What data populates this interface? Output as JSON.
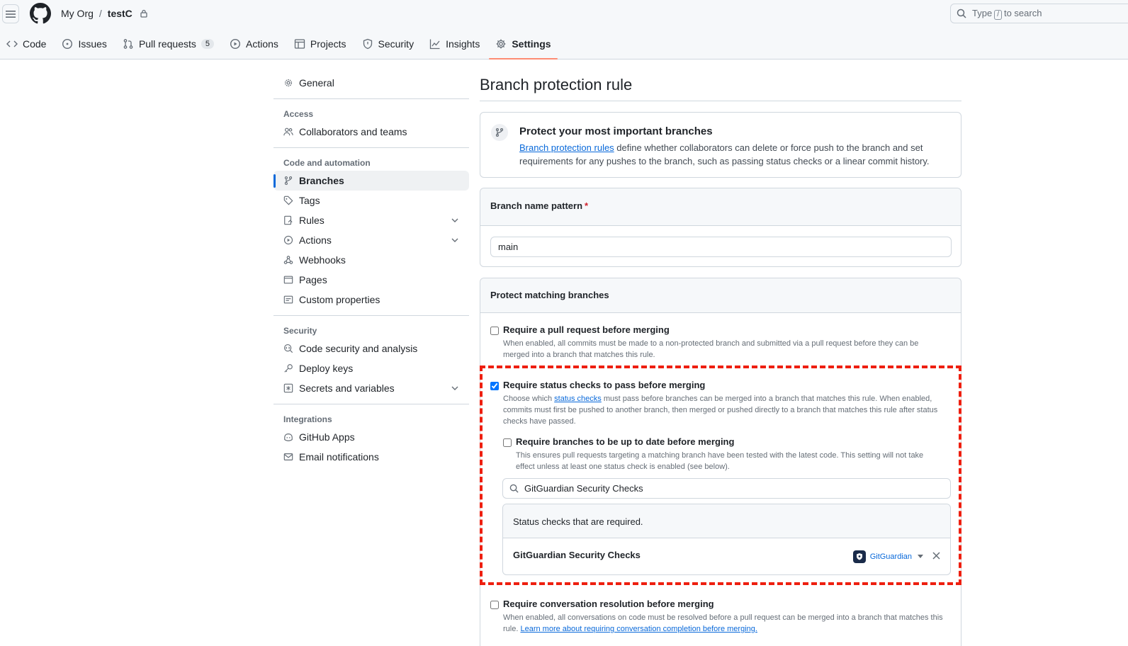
{
  "header": {
    "org": "My Org",
    "separator": "/",
    "repo": "testC",
    "search_pre": "Type",
    "search_key": "/",
    "search_post": "to search"
  },
  "tabs": [
    {
      "label": "Code",
      "icon": "code-icon"
    },
    {
      "label": "Issues",
      "icon": "issue-icon"
    },
    {
      "label": "Pull requests",
      "icon": "pull-request-icon",
      "count": "5"
    },
    {
      "label": "Actions",
      "icon": "play-icon"
    },
    {
      "label": "Projects",
      "icon": "table-icon"
    },
    {
      "label": "Security",
      "icon": "shield-icon"
    },
    {
      "label": "Insights",
      "icon": "graph-icon"
    },
    {
      "label": "Settings",
      "icon": "gear-icon",
      "active": true
    }
  ],
  "sidebar": {
    "general": "General",
    "access_heading": "Access",
    "collaborators": "Collaborators and teams",
    "code_heading": "Code and automation",
    "branches": "Branches",
    "tags": "Tags",
    "rules": "Rules",
    "actions": "Actions",
    "webhooks": "Webhooks",
    "pages": "Pages",
    "custom_properties": "Custom properties",
    "security_heading": "Security",
    "code_security": "Code security and analysis",
    "deploy_keys": "Deploy keys",
    "secrets": "Secrets and variables",
    "integrations_heading": "Integrations",
    "github_apps": "GitHub Apps",
    "email_notifications": "Email notifications"
  },
  "main": {
    "title": "Branch protection rule",
    "intro_title": "Protect your most important branches",
    "intro_link": "Branch protection rules",
    "intro_text": " define whether collaborators can delete or force push to the branch and set requirements for any pushes to the branch, such as passing status checks or a linear commit history.",
    "pattern_label": "Branch name pattern",
    "pattern_required": "*",
    "pattern_value": "main",
    "protect_heading": "Protect matching branches",
    "opt_pr_title": "Require a pull request before merging",
    "opt_pr_desc": "When enabled, all commits must be made to a non-protected branch and submitted via a pull request before they can be merged into a branch that matches this rule.",
    "opt_status_title": "Require status checks to pass before merging",
    "opt_status_desc_pre": "Choose which ",
    "opt_status_desc_link": "status checks",
    "opt_status_desc_post": " must pass before branches can be merged into a branch that matches this rule. When enabled, commits must first be pushed to another branch, then merged or pushed directly to a branch that matches this rule after status checks have passed.",
    "opt_uptodate_title": "Require branches to be up to date before merging",
    "opt_uptodate_desc": "This ensures pull requests targeting a matching branch have been tested with the latest code. This setting will not take effect unless at least one status check is enabled (see below).",
    "check_search_value": "GitGuardian Security Checks",
    "checks_required_heading": "Status checks that are required.",
    "check_name": "GitGuardian Security Checks",
    "check_app": "GitGuardian",
    "opt_conv_title": "Require conversation resolution before merging",
    "opt_conv_desc_pre": "When enabled, all conversations on code must be resolved before a pull request can be merged into a branch that matches this rule. ",
    "opt_conv_desc_link": "Learn more about requiring conversation completion before merging."
  },
  "colors": {
    "accent": "#0969da",
    "active_tab_underline": "#fd8c73",
    "highlight_dash": "#ee1f0f"
  }
}
